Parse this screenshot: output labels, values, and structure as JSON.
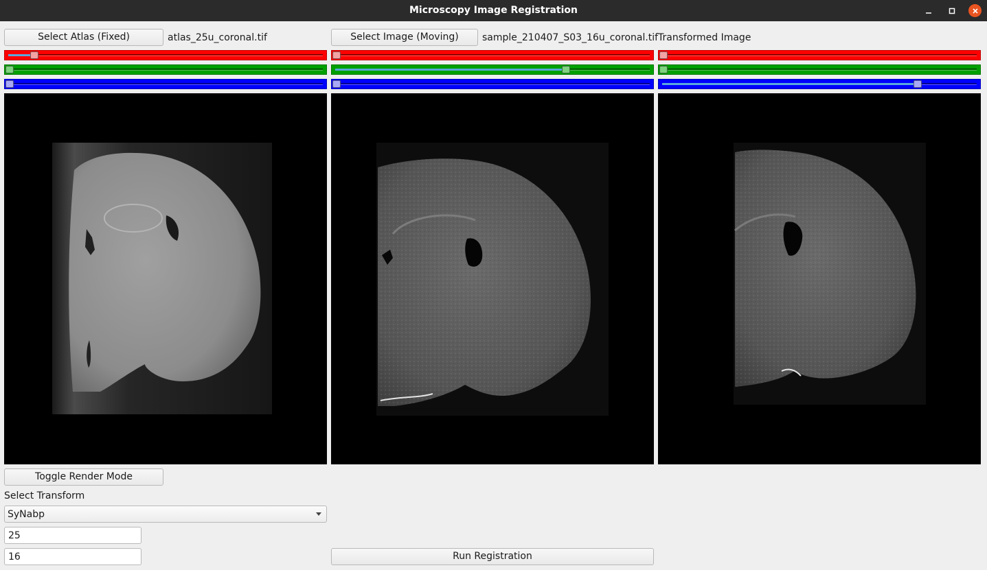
{
  "window": {
    "title": "Microscopy Image Registration",
    "accent": "#e95420"
  },
  "fixed": {
    "button_label": "Select Atlas (Fixed)",
    "filename": "atlas_25u_coronal.tif",
    "sliders": {
      "red": 0.08,
      "green": 0.0,
      "blue": 0.0
    }
  },
  "moving": {
    "button_label": "Select Image (Moving)",
    "filename": "sample_210407_S03_16u_coronal.tif",
    "sliders": {
      "red": 0.0,
      "green": 0.735,
      "blue": 0.0
    }
  },
  "transformed": {
    "label": "Transformed Image",
    "sliders": {
      "red": 0.0,
      "green": 0.0,
      "blue": 0.815
    }
  },
  "controls": {
    "toggle_render_label": "Toggle Render Mode",
    "select_transform_label": "Select Transform",
    "transform_selected": "SyNabp",
    "fixed_resolution": "25",
    "moving_resolution": "16",
    "run_label": "Run Registration"
  }
}
